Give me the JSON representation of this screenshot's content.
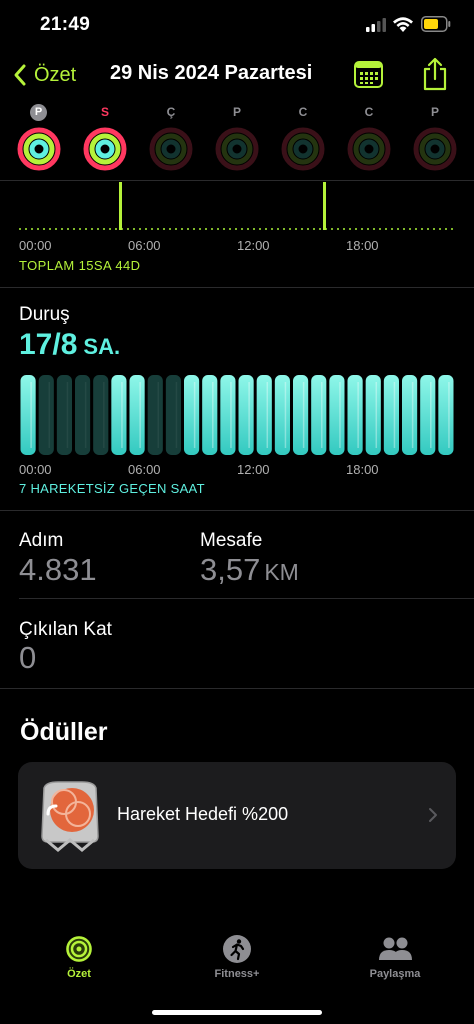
{
  "status_bar": {
    "time": "21:49"
  },
  "nav": {
    "back_label": "Özet",
    "title": "29 Nis 2024 Pazartesi"
  },
  "week": {
    "days": [
      {
        "label": "P",
        "state": "selected"
      },
      {
        "label": "S",
        "state": "today"
      },
      {
        "label": "Ç",
        "state": "future"
      },
      {
        "label": "P",
        "state": "future"
      },
      {
        "label": "C",
        "state": "future"
      },
      {
        "label": "C",
        "state": "future"
      },
      {
        "label": "P",
        "state": "future"
      }
    ]
  },
  "exercise": {
    "axis_labels": [
      "00:00",
      "06:00",
      "12:00",
      "18:00"
    ],
    "total": "TOPLAM 15SA 44D"
  },
  "stand": {
    "title": "Duruş",
    "value": "17/8",
    "unit": "SA.",
    "axis_labels": [
      "00:00",
      "06:00",
      "12:00",
      "18:00"
    ],
    "note": "7 HAREKETSİZ GEÇEN SAAT",
    "hours_stood": [
      1,
      0,
      0,
      0,
      0,
      1,
      1,
      0,
      0,
      1,
      1,
      1,
      1,
      1,
      1,
      1,
      1,
      1,
      1,
      1,
      1,
      1,
      1,
      1
    ]
  },
  "stats": {
    "steps_label": "Adım",
    "steps_value": "4.831",
    "distance_label": "Mesafe",
    "distance_value": "3,57",
    "distance_unit": "KM",
    "floors_label": "Çıkılan Kat",
    "floors_value": "0"
  },
  "awards": {
    "title": "Ödüller",
    "items": [
      {
        "label": "Hareket Hedefi %200"
      }
    ]
  },
  "tabs": [
    {
      "label": "Özet",
      "active": true
    },
    {
      "label": "Fitness+",
      "active": false
    },
    {
      "label": "Paylaşma",
      "active": false
    }
  ],
  "colors": {
    "accent": "#b5f23a",
    "move": "#ff3860",
    "exercise": "#b5f23a",
    "stand": "#5ff0e0"
  }
}
